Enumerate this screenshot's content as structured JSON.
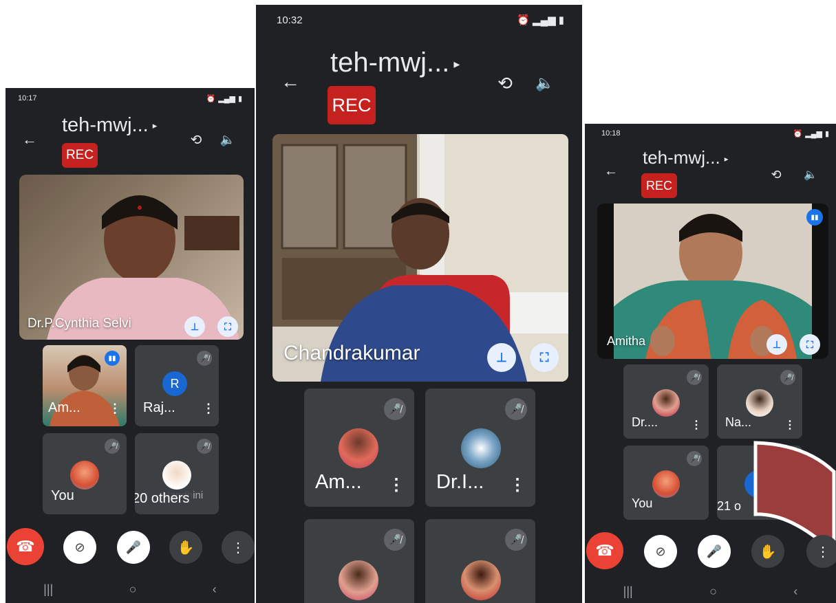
{
  "phone_left": {
    "time": "10:17",
    "meeting_title": "teh-mwj...",
    "rec_label": "REC",
    "main_speaker": "Dr.P.Cynthia Selvi",
    "tiles": [
      {
        "name": "Am...",
        "initial": ""
      },
      {
        "name": "Raj...",
        "initial": "R"
      },
      {
        "name": "You",
        "initial": ""
      },
      {
        "name": "20 others",
        "behind": "Nandhini"
      }
    ]
  },
  "phone_middle": {
    "time": "10:32",
    "meeting_title": "teh-mwj...",
    "rec_label": "REC",
    "main_speaker": "Chandrakumar",
    "tiles": [
      {
        "name": "Am..."
      },
      {
        "name": "Dr.I..."
      }
    ]
  },
  "phone_right": {
    "time": "10:18",
    "meeting_title": "teh-mwj...",
    "rec_label": "REC",
    "main_speaker": "Amitha",
    "tiles": [
      {
        "name": "Dr...."
      },
      {
        "name": "Na..."
      },
      {
        "name": "You"
      },
      {
        "name": "21 o"
      }
    ]
  },
  "colors": {
    "background": "#202124",
    "tile": "#3c4043",
    "rec": "#c5221f",
    "end_call": "#ea4335",
    "accent": "#1a73e8",
    "decor_shape": "#9b3d3d"
  }
}
